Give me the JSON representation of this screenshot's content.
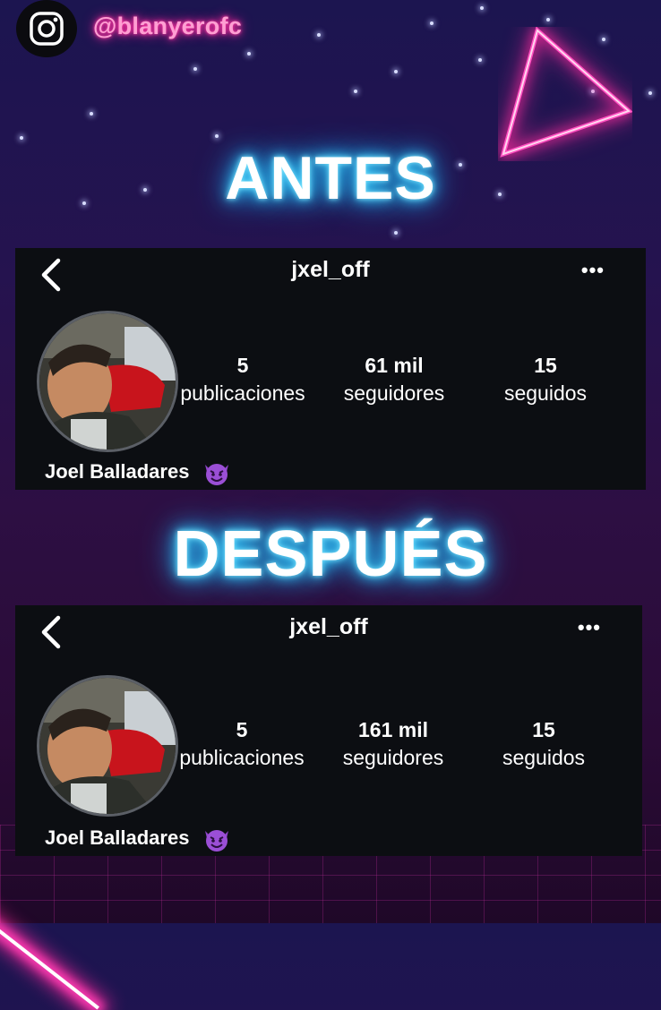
{
  "banner": {
    "instagram_handle": "@blanyerofc",
    "before_title": "ANTES",
    "after_title": "DESPUÉS"
  },
  "profiles": [
    {
      "username": "jxel_off",
      "posts_count": "5",
      "posts_label": "publicaciones",
      "followers_count": "61 mil",
      "followers_label": "seguidores",
      "following_count": "15",
      "following_label": "seguidos",
      "display_name": "Joel Balladares"
    },
    {
      "username": "jxel_off",
      "posts_count": "5",
      "posts_label": "publicaciones",
      "followers_count": "161 mil",
      "followers_label": "seguidores",
      "following_count": "15",
      "following_label": "seguidos",
      "display_name": "Joel Balladares"
    }
  ],
  "icons": {
    "back": "chevron-left-icon",
    "more": "more-dots-icon",
    "emoji": "smiling-devil-emoji-icon",
    "social": "instagram-icon"
  },
  "colors": {
    "neon_blue": "#3fd2ff",
    "neon_pink": "#ff2a9e",
    "card_bg": "#0c0e12"
  }
}
